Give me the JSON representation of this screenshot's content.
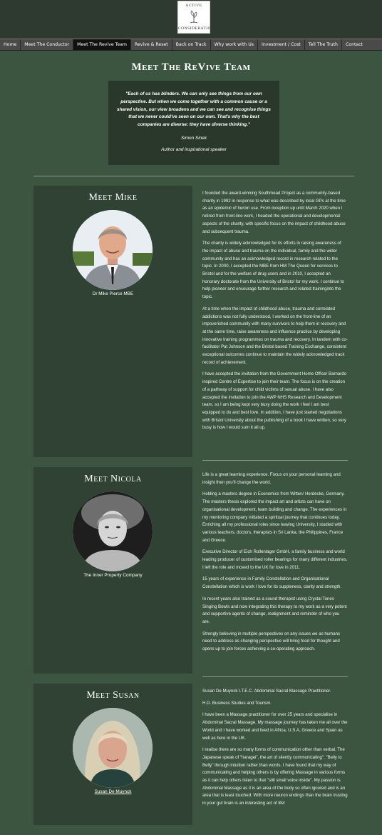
{
  "logo": {
    "line1": "ACTIVE",
    "line2": "CONSIDERATION"
  },
  "nav": {
    "items": [
      "Home",
      "Meet The Conductor",
      "Meet The Revive Team",
      "Revive & Reset",
      "Back on Track",
      "Why work with Us",
      "Investment / Cost",
      "Tell The Truth",
      "Contact"
    ],
    "active": "Meet The Revive Team"
  },
  "page_title": "Meet The ReVive Team",
  "quote": {
    "text": "\"Each of us has blinders. We can only see things from our own perspective. But when we come together with a common cause or a shared vision, our view broadens and we can see and recognise things that we never could've seen on our own. That's why the best companies are diverse: they have",
    "emphasis": "diverse thinking.\"",
    "author": "Simon Sinek",
    "role": "Author and inspirational speaker"
  },
  "members": [
    {
      "title": "Meet Mike",
      "caption": "Dr Mike Pierce MBE",
      "paragraphs": [
        "I founded the award-winning Southmead Project as a community-based charity in 1992 in response to what was described by local GPs at the time as an epidemic of heroin use. From inception up until March 2020 when I retired from front-line work, I headed the operational and developmental aspects of the charity, with specific focus on the impact of childhood abuse and subsequent trauma.",
        "The charity is widely acknowledged for its efforts in raising awareness of the impact of abuse and trauma on the individual, family and the wider community and has an acknowledged record in research related to the topic. In 2000, I accepted the MBE from HM The Queen for services to Bristol and for the welfare of drug users and in 2010, I accepted an honorary doctorate from the University of Bristol for my work. I continue to help pioneer and encourage further research and related traininginto the topic.",
        "At a time when the impact of childhood abuse, trauma and correlated addictions was not fully understood, I worked on the front-line of an impoverished community with many survivors to help them in recovery and at the same time, raise awareness and influence practice by developing innovative training programmes on trauma and recovery. In tandem with co-facilitator Pat Johnson and the Bristol based Training Exchange, consistent exceptional outcomes continue to maintain the widely acknowledged track record of achievement.",
        "I have accepted the invitation from the Government Home Office/ Barnardo inspired Centre of Expertise to join their team. The focus is on the creation of a pathway of support for child victims of sexual abuse. I have also accepted the invitation to join the AWP NHS Research and Development team, so I am being kept very busy doing the work I feel I am best equipped to do and best love. In addition, I have just started negotiations with Bristol University about the publishing of a book I have written, so very busy is how I would sum it all up."
      ]
    },
    {
      "title": "Meet Nicola",
      "caption": "The Inner Property Company",
      "paragraphs": [
        "Life is a great learning experience. Focus on your personal learning and insight then you'll change the world.",
        "Holding a masters degree in Economics from Witten/ Herdecke, Germany. The masters thesis explored the impact art and artists can have on organisational development, team building and change. The experiences in my mentoring company initiated a spiritual journey that continues today. Enriching all my professional roles since leaving University, I studied with various teachers, doctors, therapists in Sri Lanka, the Philippines, France and Greece.",
        "Executive Director of Eich Rollenlager GmbH, a family business and world leading producer of customised roller bearings for many different industries. I left the role and moved to the UK for love in 2011.",
        "15 years of experience in Family Constellation and Organisational Constellation which is work I love for its suppleness, clarity and strength.",
        "In recent years also trained as a sound therapist using Crystal Tones Singing Bowls and now integrating this therapy to my work as a very potent and supportive agents of change, realignment and reminder of who you are.",
        "Strongly believing in multiple perspectives on any issues we as humans need to address as changing perspective will bring food for thought and opens up to join forces achieving a co-operating approach."
      ]
    },
    {
      "title": "Meet Susan",
      "caption": "Susan De Muynck",
      "paragraphs": [
        "Susan De Muynck I.T.E.C. Abdominal Sacral Massage Practitioner.",
        "H.D. Business Studies and Tourism.",
        "I have been a Massage practitioner for over 25 years and specialise in Abdominal Sacral Massage. My massage journey has taken me all over the World and I have worked and lived in Africa, U.S.A, Greece and Spain as well as here in the UK.",
        "I realise there are so many forms of communication other than verbal. The Japanese speak of \"haragei\", the art of silently communicating\". \"Belly to Belly\" through intuition rather than words. I have found that my way of communicating and helping others is by offering Massage in various forms as it can help others listen to that \"still small voice inside\". My passion is Abdominal Massage as it is an area of the body so often ignored and is an area that is least touched. With more neuron endings than the brain trusting in your gut brain is an interesting act of life!"
      ]
    }
  ]
}
